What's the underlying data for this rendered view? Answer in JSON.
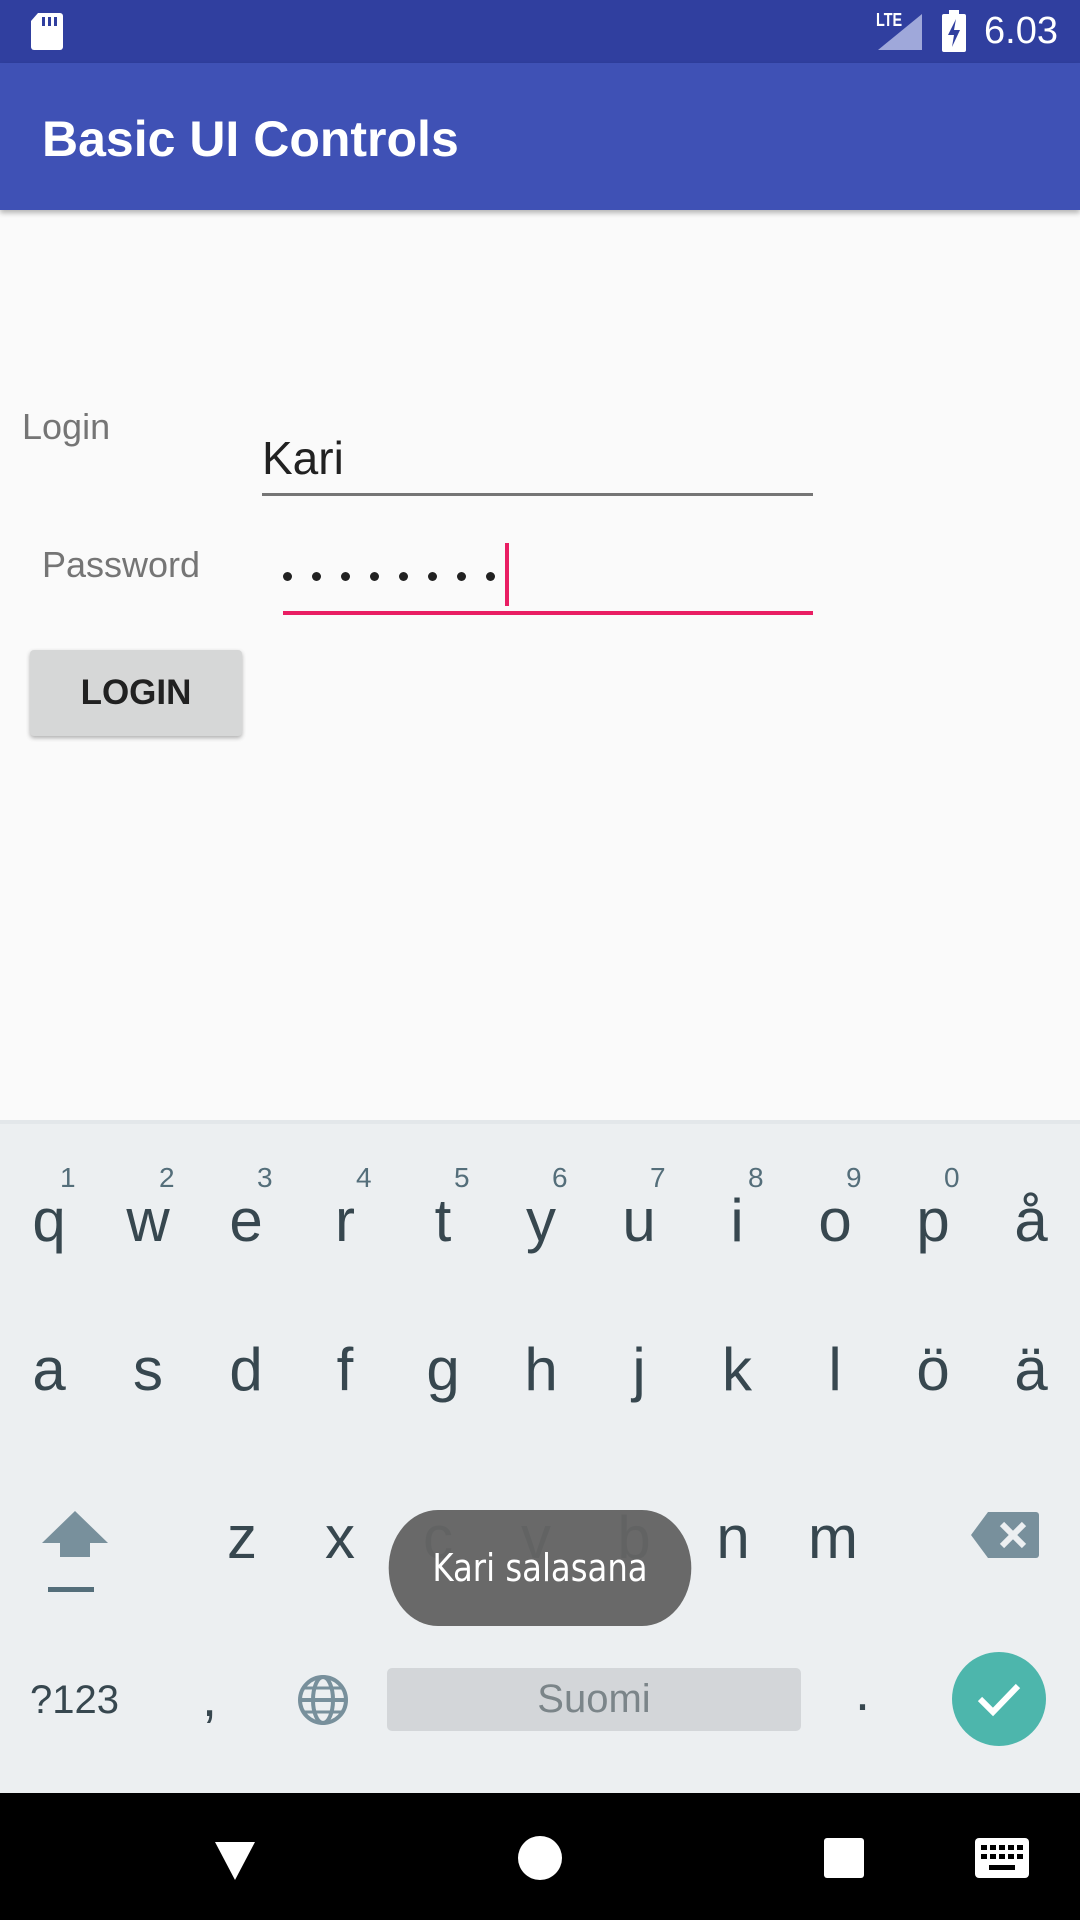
{
  "status_bar": {
    "network_label": "LTE",
    "time": "6.03",
    "icons": [
      "sd-card-icon",
      "signal-icon",
      "battery-charging-icon"
    ]
  },
  "app_bar": {
    "title": "Basic UI Controls"
  },
  "form": {
    "login_label": "Login",
    "login_value": "Kari",
    "password_label": "Password",
    "password_dot_count": 8,
    "login_button": "LOGIN"
  },
  "keyboard": {
    "row1": [
      {
        "key": "q",
        "hint": "1"
      },
      {
        "key": "w",
        "hint": "2"
      },
      {
        "key": "e",
        "hint": "3"
      },
      {
        "key": "r",
        "hint": "4"
      },
      {
        "key": "t",
        "hint": "5"
      },
      {
        "key": "y",
        "hint": "6"
      },
      {
        "key": "u",
        "hint": "7"
      },
      {
        "key": "i",
        "hint": "8"
      },
      {
        "key": "o",
        "hint": "9"
      },
      {
        "key": "p",
        "hint": "0"
      },
      {
        "key": "å",
        "hint": ""
      }
    ],
    "row2": [
      "a",
      "s",
      "d",
      "f",
      "g",
      "h",
      "j",
      "k",
      "l",
      "ö",
      "ä"
    ],
    "row3": [
      "z",
      "x",
      "c",
      "v",
      "b",
      "n",
      "m"
    ],
    "symbols_key": "?123",
    "comma_key": ",",
    "space_label": "Suomi",
    "period_key": ".",
    "icons": [
      "shift-icon",
      "backspace-icon",
      "globe-icon",
      "checkmark-icon"
    ],
    "enter_color": "#4db6ac"
  },
  "toast": {
    "message": "Kari salasana"
  },
  "colors": {
    "status_bar": "#303f9f",
    "app_bar": "#3f51b5",
    "accent": "#e91e63"
  }
}
